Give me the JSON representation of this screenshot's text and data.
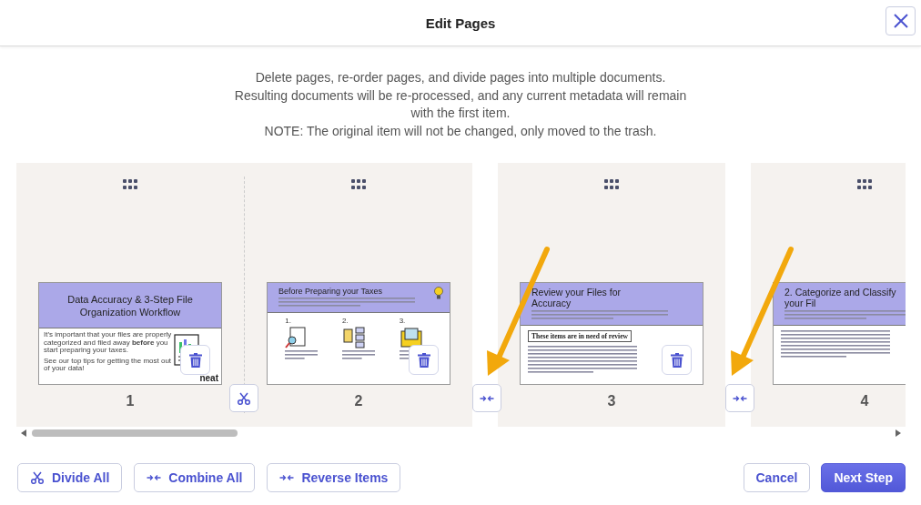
{
  "window": {
    "title": "Edit Pages"
  },
  "description": [
    "Delete pages, re-order pages, and divide pages into multiple documents.",
    "Resulting documents will be re-processed, and any current metadata will remain",
    "with the first item.",
    "NOTE: The original item will not be changed, only moved to the trash."
  ],
  "documents": [
    {
      "pages": [
        {
          "number": "1",
          "thumbnail": {
            "kind": "cover",
            "title": "Data Accuracy & 3-Step File Organization Workflow",
            "paragraphs": [
              "It’s important that your files are properly categorized and filed away **before** you start preparing your taxes.",
              "See our top tips for getting the most out of your data!"
            ],
            "logo": "neat",
            "delete_button": true
          }
        },
        {
          "number": "2",
          "thumbnail": {
            "kind": "steps",
            "title": "Before Preparing your Taxes",
            "steps": [
              "1.",
              "2.",
              "3."
            ],
            "delete_button": true
          }
        }
      ]
    },
    {
      "pages": [
        {
          "number": "3",
          "thumbnail": {
            "kind": "article",
            "title": "Review your Files for Accuracy",
            "box_heading": "These items are in need of review",
            "delete_button": true
          }
        }
      ]
    },
    {
      "pages": [
        {
          "number": "4",
          "thumbnail": {
            "kind": "article",
            "title": "2. Categorize and Classify your Fil"
          }
        }
      ]
    }
  ],
  "footer": {
    "left_buttons": [
      {
        "kind": "divide",
        "label": "Divide All"
      },
      {
        "kind": "combine",
        "label": "Combine All"
      },
      {
        "kind": "combine",
        "label": "Reverse Items"
      }
    ],
    "cancel": "Cancel",
    "next": "Next Step"
  }
}
